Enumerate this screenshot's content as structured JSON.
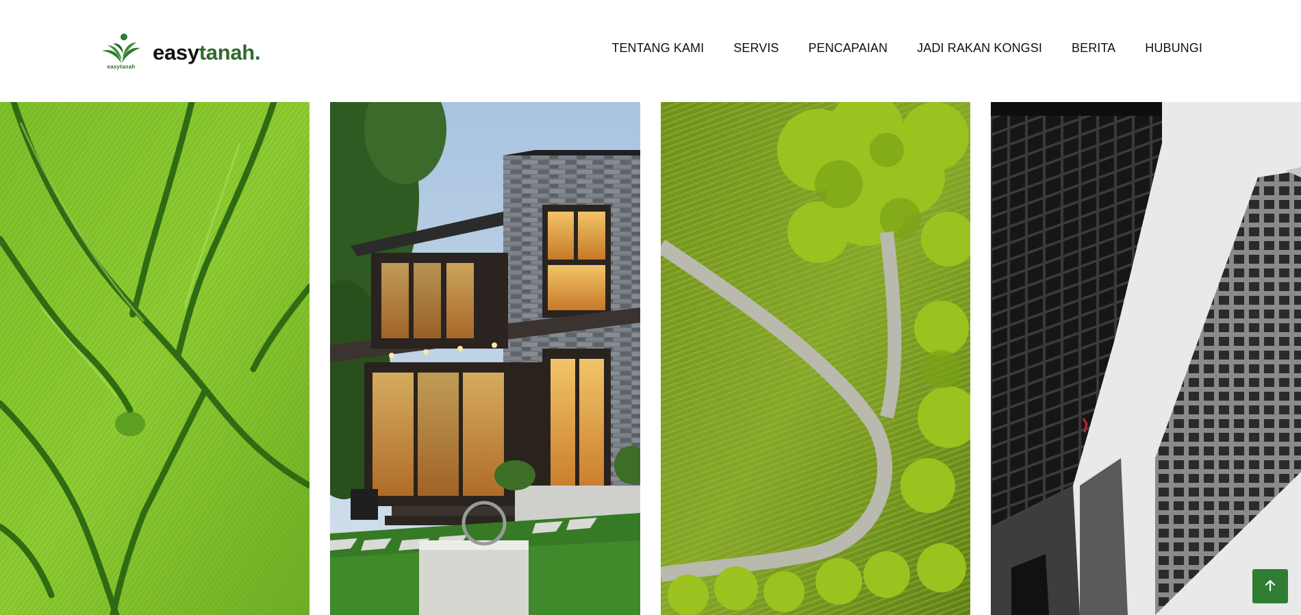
{
  "brand": {
    "name_part1": "easy",
    "name_part2": "tanah.",
    "logo_caption": "easytanah",
    "logo_icon": "sprout-logo-icon",
    "brand_green": "#2e6b2e"
  },
  "nav": {
    "items": [
      {
        "label": "TENTANG KAMI"
      },
      {
        "label": "SERVIS"
      },
      {
        "label": "PENCAPAIAN"
      },
      {
        "label": "JADI RAKAN KONGSI"
      },
      {
        "label": "BERITA"
      },
      {
        "label": "HUBUNGI"
      }
    ]
  },
  "gallery": {
    "images": [
      {
        "subject": "rice-field-aerial"
      },
      {
        "subject": "modern-house"
      },
      {
        "subject": "green-park-road"
      },
      {
        "subject": "skyscrapers"
      }
    ]
  },
  "back_to_top": {
    "icon": "arrow-up-icon",
    "color": "#2e7d32"
  }
}
